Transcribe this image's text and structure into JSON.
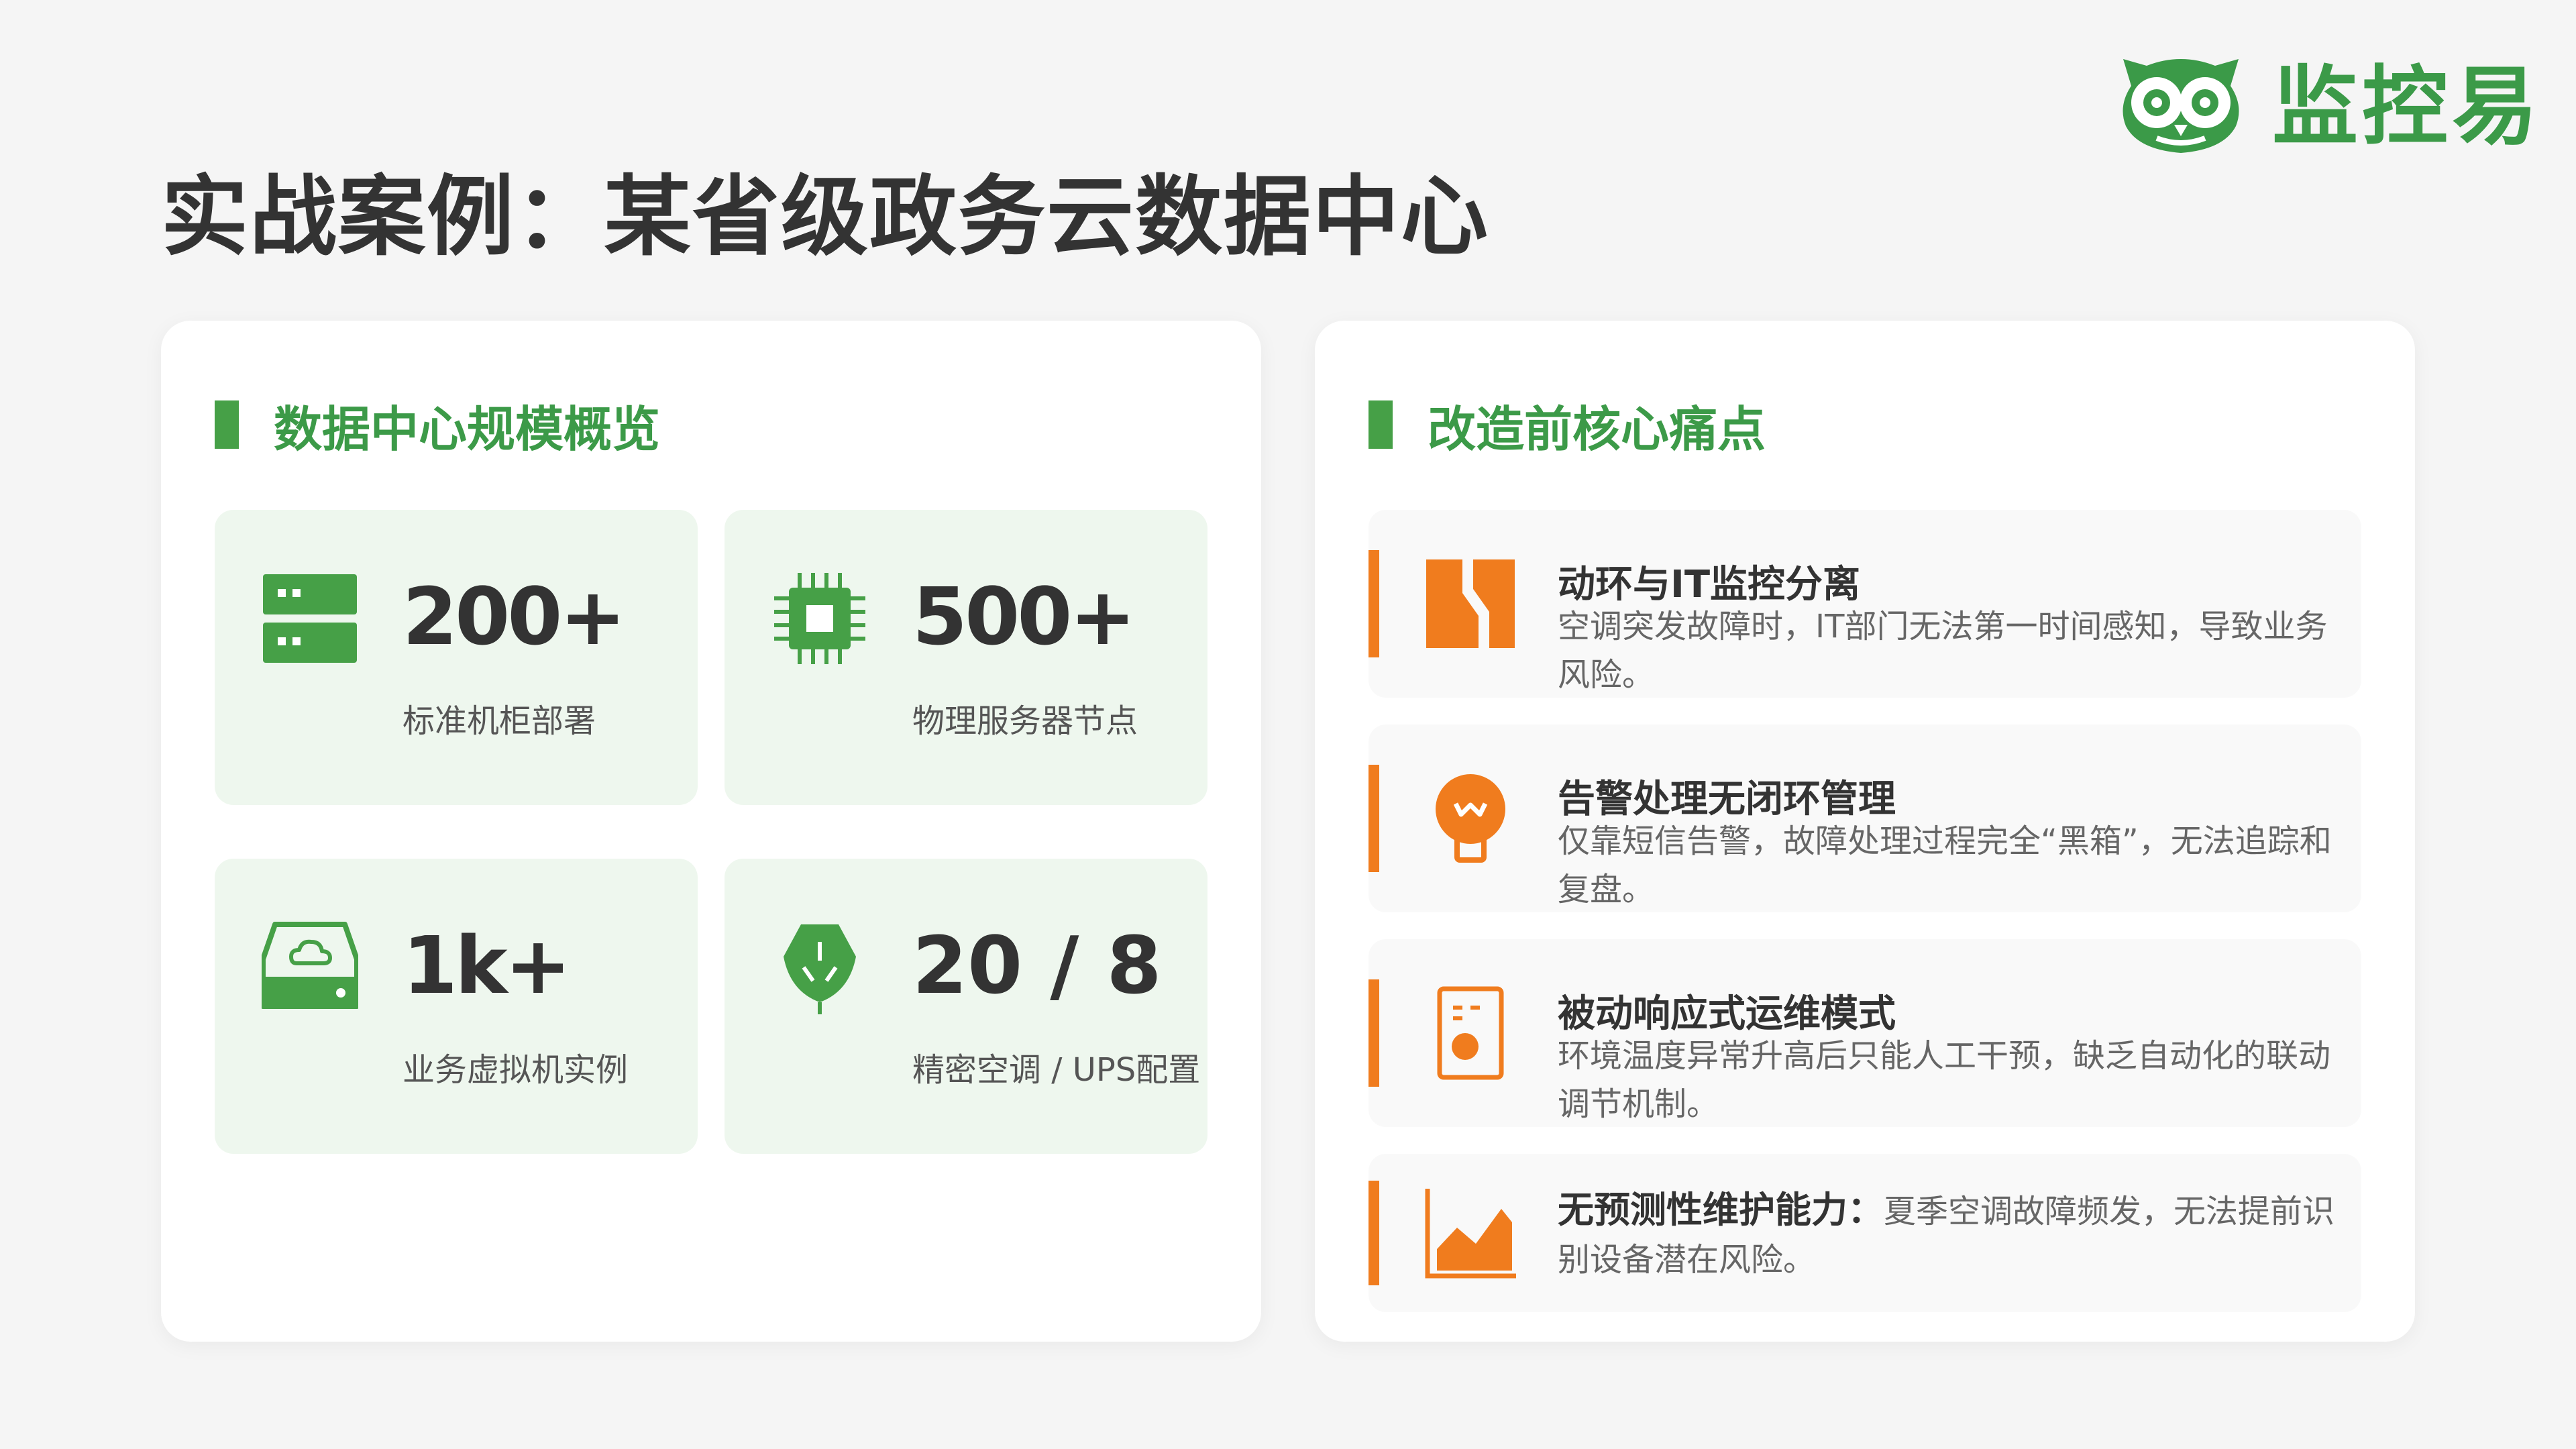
{
  "page": {
    "title": "实战案例：某省级政务云数据中心"
  },
  "logo": {
    "text": "监控易",
    "icon": "owl-logo-icon",
    "color": "#3b9a48"
  },
  "left_panel": {
    "title": "数据中心规模概览",
    "stats": [
      {
        "value": "200+",
        "label": "标准机柜部署",
        "icon": "server-rack-icon"
      },
      {
        "value": "500+",
        "label": "物理服务器节点",
        "icon": "cpu-chip-icon"
      },
      {
        "value": "1k+",
        "label": "业务虚拟机实例",
        "icon": "cloud-drive-icon"
      },
      {
        "value": "20 / 8",
        "label": "精密空调 / UPS配置",
        "icon": "leaf-shield-icon"
      }
    ]
  },
  "right_panel": {
    "title": "改造前核心痛点",
    "items": [
      {
        "title": "动环与IT监控分离",
        "desc": "空调突发故障时，IT部门无法第一时间感知，导致业务风险。",
        "icon": "split-blocks-icon"
      },
      {
        "title": "告警处理无闭环管理",
        "desc": "仅靠短信告警，故障处理过程完全“黑箱”，无法追踪和复盘。",
        "icon": "lightbulb-icon"
      },
      {
        "title": "被动响应式运维模式",
        "desc": "环境温度异常升高后只能人工干预，缺乏自动化的联动调节机制。",
        "icon": "speaker-device-icon"
      },
      {
        "title": "无预测性维护能力：",
        "desc": "夏季空调故障频发，无法提前识别设备潜在风险。",
        "icon": "area-chart-icon"
      }
    ]
  },
  "colors": {
    "green": "#46a047",
    "green_light": "#eef7ee",
    "orange": "#f07c1e",
    "text_dark": "#333333",
    "text_muted": "#666666"
  }
}
